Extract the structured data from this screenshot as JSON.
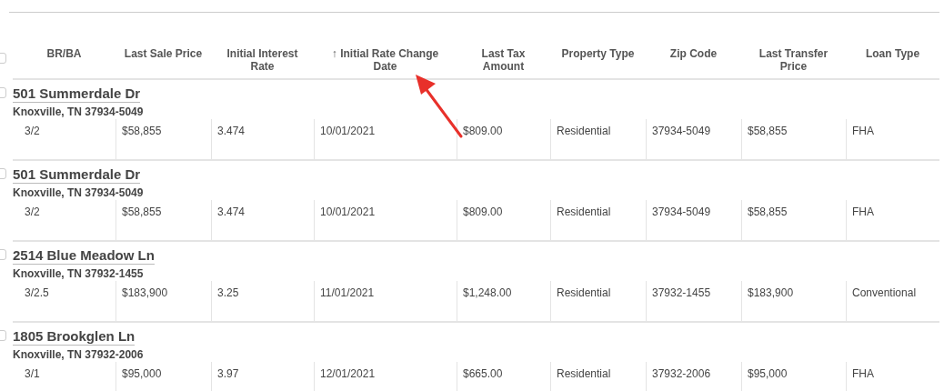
{
  "table": {
    "header_checkbox": {
      "checked": false
    },
    "columns": [
      "BR/BA",
      "Last Sale Price",
      "Initial Interest Rate",
      "↑ Initial Rate Change Date",
      "Last Tax Amount",
      "Property Type",
      "Zip Code",
      "Last Transfer Price",
      "Loan Type"
    ],
    "rows": [
      {
        "checked": false,
        "address": "501 Summerdale Dr",
        "city": "Knoxville, TN 37934-5049",
        "cells": [
          "3/2",
          "$58,855",
          "3.474",
          "10/01/2021",
          "$809.00",
          "Residential",
          "37934-5049",
          "$58,855",
          "FHA"
        ]
      },
      {
        "checked": false,
        "address": "501 Summerdale Dr",
        "city": "Knoxville, TN 37934-5049",
        "cells": [
          "3/2",
          "$58,855",
          "3.474",
          "10/01/2021",
          "$809.00",
          "Residential",
          "37934-5049",
          "$58,855",
          "FHA"
        ]
      },
      {
        "checked": false,
        "address": "2514 Blue Meadow Ln",
        "city": "Knoxville, TN 37932-1455",
        "cells": [
          "3/2.5",
          "$183,900",
          "3.25",
          "11/01/2021",
          "$1,248.00",
          "Residential",
          "37932-1455",
          "$183,900",
          "Conventional"
        ]
      },
      {
        "checked": false,
        "address": "1805 Brookglen Ln",
        "city": "Knoxville, TN 37932-2006",
        "cells": [
          "3/1",
          "$95,000",
          "3.97",
          "12/01/2021",
          "$665.00",
          "Residential",
          "37932-2006",
          "$95,000",
          "FHA"
        ]
      }
    ]
  }
}
